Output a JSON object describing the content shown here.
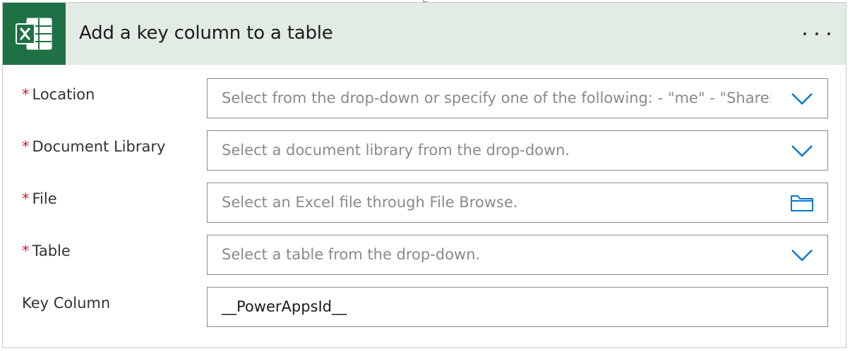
{
  "header": {
    "title": "Add a key column to a table",
    "app_icon": "excel-icon",
    "more_icon": "ellipsis-icon",
    "bg_color": "#e2ece4",
    "icon_color": "#1e7145"
  },
  "fields": [
    {
      "label": "Location",
      "required": true,
      "placeholder": "Select from the drop-down or specify one of the following: - \"me\" - \"SharePoint Site URL\"",
      "icon": "chevron-down-icon"
    },
    {
      "label": "Document Library",
      "required": true,
      "placeholder": "Select a document library from the drop-down.",
      "icon": "chevron-down-icon"
    },
    {
      "label": "File",
      "required": true,
      "placeholder": "Select an Excel file through File Browse.",
      "icon": "folder-icon"
    },
    {
      "label": "Table",
      "required": true,
      "placeholder": "Select a table from the drop-down.",
      "icon": "chevron-down-icon"
    },
    {
      "label": "Key Column",
      "required": false,
      "value": "__PowerAppsId__"
    }
  ],
  "required_marker": "*",
  "colors": {
    "accent": "#0078d4",
    "required": "#c4262e"
  }
}
